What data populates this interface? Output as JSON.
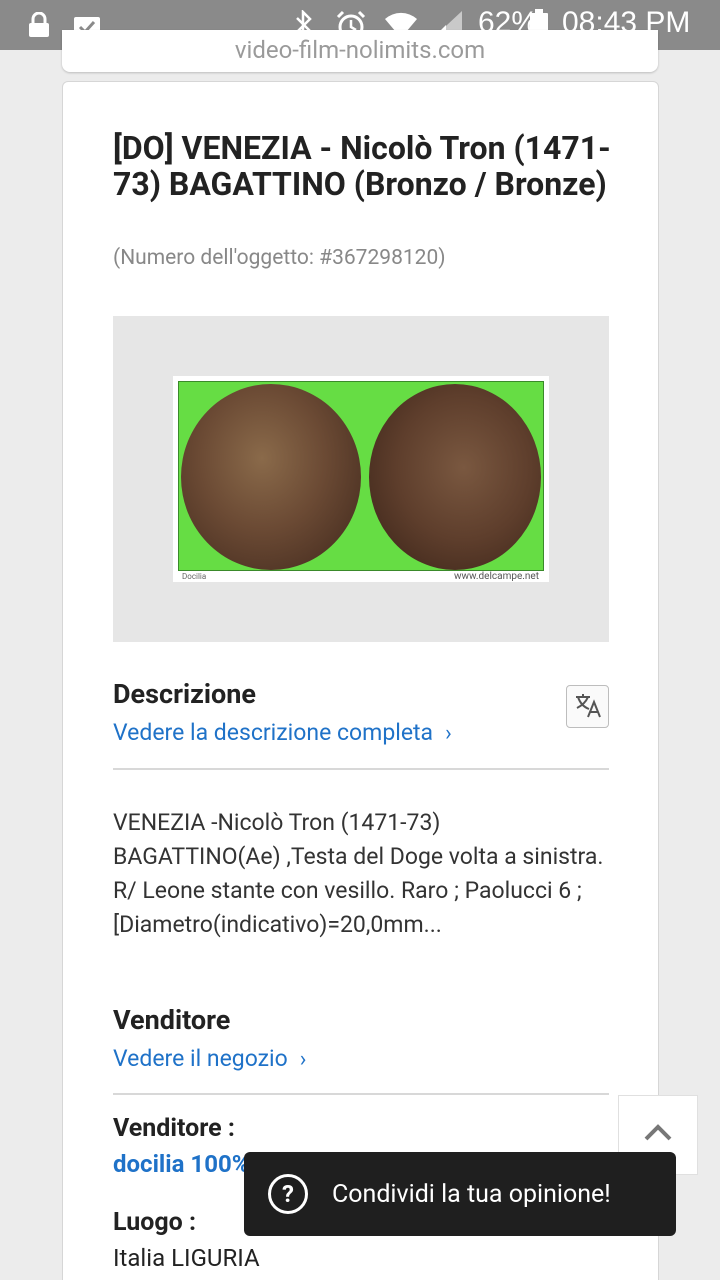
{
  "status_bar": {
    "battery": "62%",
    "time": "08:43 PM",
    "icons": [
      "lock-icon",
      "clipboard-check-icon",
      "bluetooth-icon",
      "alarm-icon",
      "wifi-icon",
      "signal-icon",
      "battery-icon"
    ]
  },
  "top_card": {
    "url_text": "video-film-nolimits.com"
  },
  "item": {
    "title": "[DO] VENEZIA - Nicolò Tron (1471-73) BAGATTINO (Bronzo / Bronze)",
    "number": "(Numero dell'oggetto: #367298120)",
    "photo_caption_left": "Docilia",
    "photo_caption_right": "www.delcampe.net"
  },
  "description": {
    "heading": "Descrizione",
    "link": "Vedere la descrizione completa",
    "text": "VENEZIA -Nicolò Tron (1471-73) BAGATTINO(Ae) ,Testa del Doge volta a sinistra. R/ Leone stante con vesillo. Raro ; Paolucci 6 ; [Diametro(indicativo)=20,0mm..."
  },
  "seller": {
    "heading": "Venditore",
    "link": "Vedere il negozio",
    "label": "Venditore :",
    "name": "docilia 100%",
    "location_label": "Luogo :",
    "location": "Italia LIGURIA"
  },
  "toast": {
    "text": "Condividi la tua opinione!"
  },
  "colors": {
    "link": "#1f72c8",
    "status_bar": "#8a8a8a",
    "toast_bg": "#1f1f1f"
  }
}
